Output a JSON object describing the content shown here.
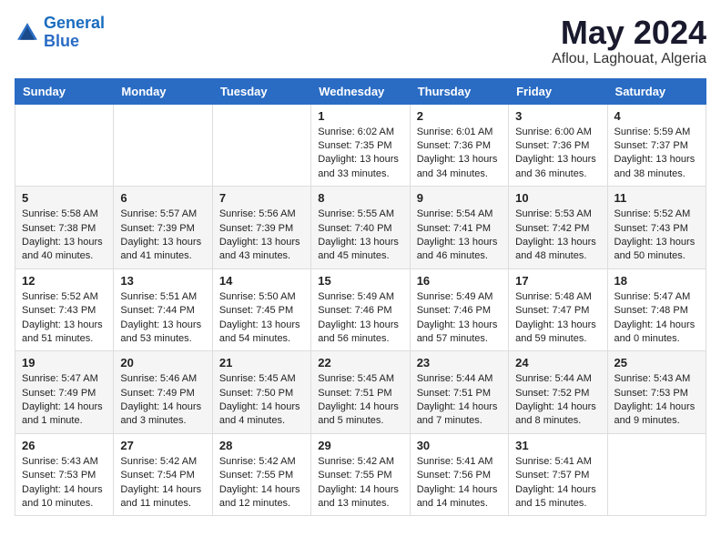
{
  "header": {
    "logo_line1": "General",
    "logo_line2": "Blue",
    "month": "May 2024",
    "location": "Aflou, Laghouat, Algeria"
  },
  "weekdays": [
    "Sunday",
    "Monday",
    "Tuesday",
    "Wednesday",
    "Thursday",
    "Friday",
    "Saturday"
  ],
  "weeks": [
    [
      {
        "day": "",
        "data": ""
      },
      {
        "day": "",
        "data": ""
      },
      {
        "day": "",
        "data": ""
      },
      {
        "day": "1",
        "data": "Sunrise: 6:02 AM\nSunset: 7:35 PM\nDaylight: 13 hours\nand 33 minutes."
      },
      {
        "day": "2",
        "data": "Sunrise: 6:01 AM\nSunset: 7:36 PM\nDaylight: 13 hours\nand 34 minutes."
      },
      {
        "day": "3",
        "data": "Sunrise: 6:00 AM\nSunset: 7:36 PM\nDaylight: 13 hours\nand 36 minutes."
      },
      {
        "day": "4",
        "data": "Sunrise: 5:59 AM\nSunset: 7:37 PM\nDaylight: 13 hours\nand 38 minutes."
      }
    ],
    [
      {
        "day": "5",
        "data": "Sunrise: 5:58 AM\nSunset: 7:38 PM\nDaylight: 13 hours\nand 40 minutes."
      },
      {
        "day": "6",
        "data": "Sunrise: 5:57 AM\nSunset: 7:39 PM\nDaylight: 13 hours\nand 41 minutes."
      },
      {
        "day": "7",
        "data": "Sunrise: 5:56 AM\nSunset: 7:39 PM\nDaylight: 13 hours\nand 43 minutes."
      },
      {
        "day": "8",
        "data": "Sunrise: 5:55 AM\nSunset: 7:40 PM\nDaylight: 13 hours\nand 45 minutes."
      },
      {
        "day": "9",
        "data": "Sunrise: 5:54 AM\nSunset: 7:41 PM\nDaylight: 13 hours\nand 46 minutes."
      },
      {
        "day": "10",
        "data": "Sunrise: 5:53 AM\nSunset: 7:42 PM\nDaylight: 13 hours\nand 48 minutes."
      },
      {
        "day": "11",
        "data": "Sunrise: 5:52 AM\nSunset: 7:43 PM\nDaylight: 13 hours\nand 50 minutes."
      }
    ],
    [
      {
        "day": "12",
        "data": "Sunrise: 5:52 AM\nSunset: 7:43 PM\nDaylight: 13 hours\nand 51 minutes."
      },
      {
        "day": "13",
        "data": "Sunrise: 5:51 AM\nSunset: 7:44 PM\nDaylight: 13 hours\nand 53 minutes."
      },
      {
        "day": "14",
        "data": "Sunrise: 5:50 AM\nSunset: 7:45 PM\nDaylight: 13 hours\nand 54 minutes."
      },
      {
        "day": "15",
        "data": "Sunrise: 5:49 AM\nSunset: 7:46 PM\nDaylight: 13 hours\nand 56 minutes."
      },
      {
        "day": "16",
        "data": "Sunrise: 5:49 AM\nSunset: 7:46 PM\nDaylight: 13 hours\nand 57 minutes."
      },
      {
        "day": "17",
        "data": "Sunrise: 5:48 AM\nSunset: 7:47 PM\nDaylight: 13 hours\nand 59 minutes."
      },
      {
        "day": "18",
        "data": "Sunrise: 5:47 AM\nSunset: 7:48 PM\nDaylight: 14 hours\nand 0 minutes."
      }
    ],
    [
      {
        "day": "19",
        "data": "Sunrise: 5:47 AM\nSunset: 7:49 PM\nDaylight: 14 hours\nand 1 minute."
      },
      {
        "day": "20",
        "data": "Sunrise: 5:46 AM\nSunset: 7:49 PM\nDaylight: 14 hours\nand 3 minutes."
      },
      {
        "day": "21",
        "data": "Sunrise: 5:45 AM\nSunset: 7:50 PM\nDaylight: 14 hours\nand 4 minutes."
      },
      {
        "day": "22",
        "data": "Sunrise: 5:45 AM\nSunset: 7:51 PM\nDaylight: 14 hours\nand 5 minutes."
      },
      {
        "day": "23",
        "data": "Sunrise: 5:44 AM\nSunset: 7:51 PM\nDaylight: 14 hours\nand 7 minutes."
      },
      {
        "day": "24",
        "data": "Sunrise: 5:44 AM\nSunset: 7:52 PM\nDaylight: 14 hours\nand 8 minutes."
      },
      {
        "day": "25",
        "data": "Sunrise: 5:43 AM\nSunset: 7:53 PM\nDaylight: 14 hours\nand 9 minutes."
      }
    ],
    [
      {
        "day": "26",
        "data": "Sunrise: 5:43 AM\nSunset: 7:53 PM\nDaylight: 14 hours\nand 10 minutes."
      },
      {
        "day": "27",
        "data": "Sunrise: 5:42 AM\nSunset: 7:54 PM\nDaylight: 14 hours\nand 11 minutes."
      },
      {
        "day": "28",
        "data": "Sunrise: 5:42 AM\nSunset: 7:55 PM\nDaylight: 14 hours\nand 12 minutes."
      },
      {
        "day": "29",
        "data": "Sunrise: 5:42 AM\nSunset: 7:55 PM\nDaylight: 14 hours\nand 13 minutes."
      },
      {
        "day": "30",
        "data": "Sunrise: 5:41 AM\nSunset: 7:56 PM\nDaylight: 14 hours\nand 14 minutes."
      },
      {
        "day": "31",
        "data": "Sunrise: 5:41 AM\nSunset: 7:57 PM\nDaylight: 14 hours\nand 15 minutes."
      },
      {
        "day": "",
        "data": ""
      }
    ]
  ]
}
